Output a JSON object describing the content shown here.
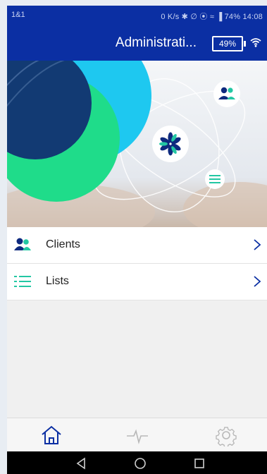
{
  "status_bar": {
    "carrier": "1&1",
    "right_text": "0 K/s ✱ ∅ ⦿ ≈  ▐ 74%  14:08"
  },
  "app_bar": {
    "title": "Administrati...",
    "battery_label": "49%",
    "icon": "wifi-icon"
  },
  "hero": {
    "colors": {
      "navy": "#123a73",
      "cyan": "#1ec8f0",
      "green": "#1fdc8a"
    },
    "icons": [
      "clients-icon",
      "logo-snowflake-icon",
      "lists-icon"
    ]
  },
  "menu": {
    "items": [
      {
        "label": "Clients",
        "icon": "clients-icon"
      },
      {
        "label": "Lists",
        "icon": "list-icon"
      }
    ]
  },
  "tab_bar": {
    "tabs": [
      {
        "icon": "home-icon",
        "active": true
      },
      {
        "icon": "activity-icon",
        "active": false
      },
      {
        "icon": "settings-icon",
        "active": false
      }
    ]
  },
  "nav_bar": {
    "buttons": [
      "back-icon",
      "home-circle-icon",
      "recents-icon"
    ]
  },
  "colors": {
    "primary": "#0b2fa3",
    "accent_teal": "#23c7a3",
    "accent_navy": "#0e2a7e"
  }
}
